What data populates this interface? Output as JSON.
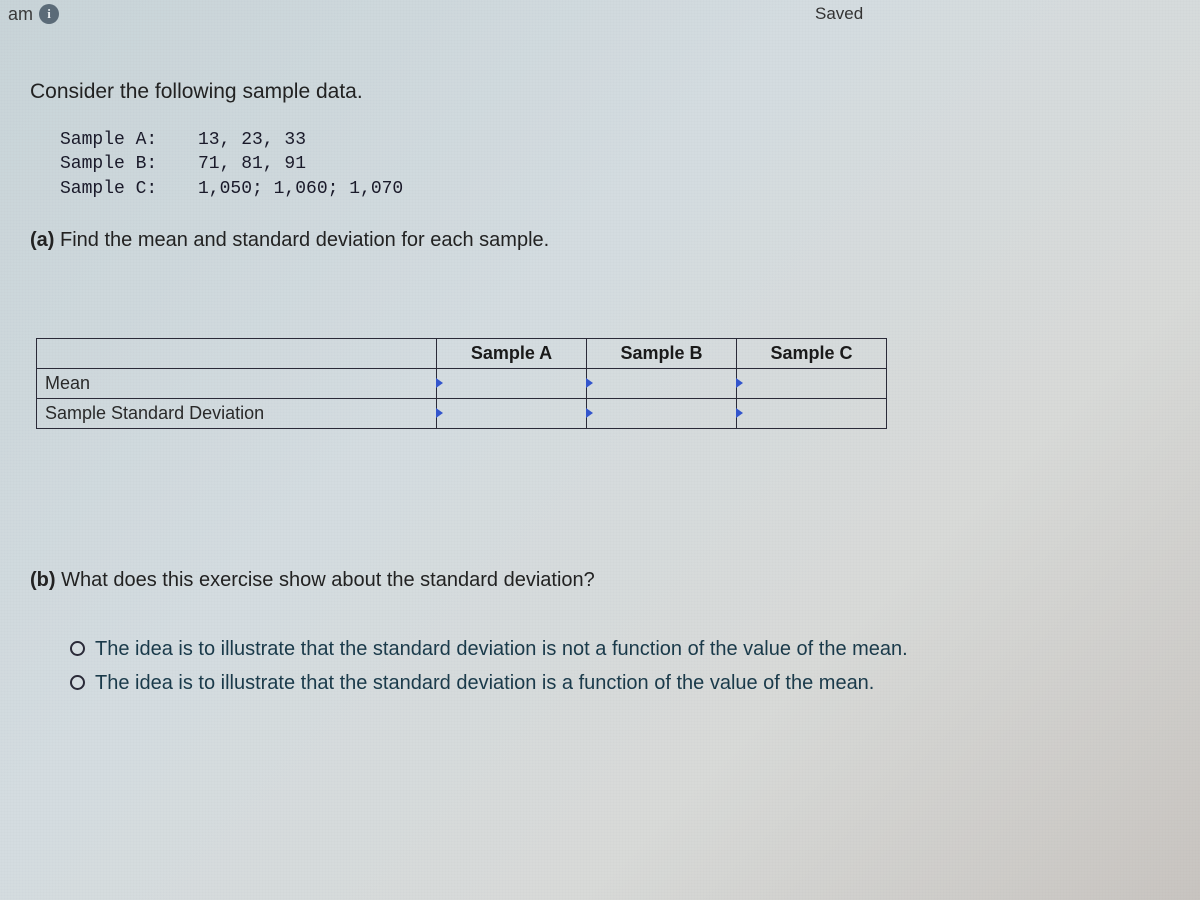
{
  "topbar": {
    "title_fragment": "am",
    "info_glyph": "i",
    "saved_label": "Saved"
  },
  "intro": "Consider the following sample data.",
  "samples": [
    {
      "label": "Sample A:",
      "values": "13, 23, 33"
    },
    {
      "label": "Sample B:",
      "values": "71, 81, 91"
    },
    {
      "label": "Sample C:",
      "values": "1,050; 1,060; 1,070"
    }
  ],
  "part_a": {
    "prefix": "(a)",
    "text": " Find the mean and standard deviation for each sample."
  },
  "table": {
    "columns": [
      "Sample A",
      "Sample B",
      "Sample C"
    ],
    "rows": [
      "Mean",
      "Sample Standard Deviation"
    ]
  },
  "part_b": {
    "prefix": "(b)",
    "text": " What does this exercise show about the standard deviation?"
  },
  "options": [
    "The idea is to illustrate that the standard deviation is not a function of the value of the mean.",
    "The idea is to illustrate that the standard deviation is a function of the value of the mean."
  ]
}
